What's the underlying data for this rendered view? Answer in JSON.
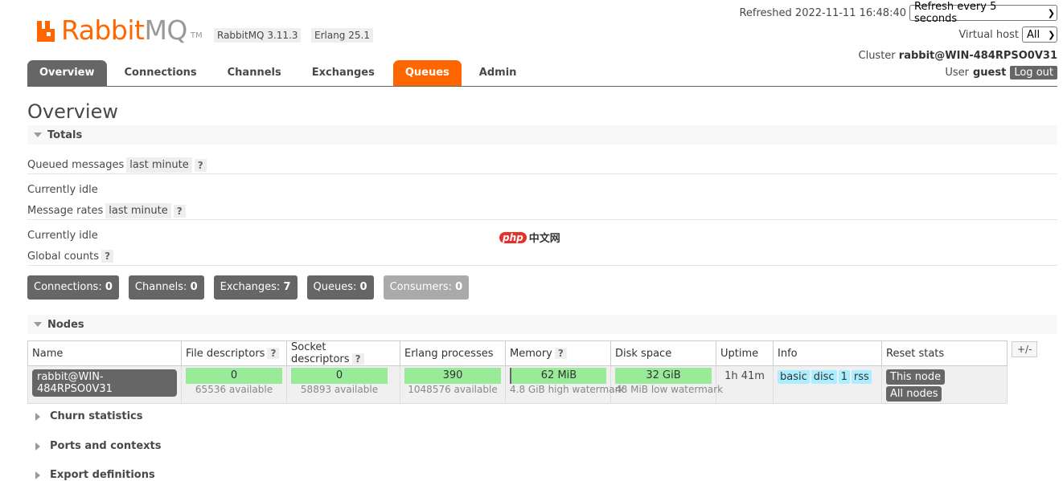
{
  "header": {
    "logo_text_1": "Rabbit",
    "logo_text_2": "MQ",
    "logo_tm": "TM",
    "version": "RabbitMQ 3.11.3",
    "erlang": "Erlang 25.1",
    "refreshed": "Refreshed 2022-11-11 16:48:40",
    "refresh_select": "Refresh every 5 seconds",
    "vhost_label": "Virtual host",
    "vhost_select": "All",
    "cluster_label": "Cluster",
    "cluster_name": "rabbit@WIN-484RPSO0V31",
    "user_label": "User",
    "user_name": "guest",
    "logout": "Log out"
  },
  "tabs": [
    "Overview",
    "Connections",
    "Channels",
    "Exchanges",
    "Queues",
    "Admin"
  ],
  "page_title": "Overview",
  "totals": {
    "header": "Totals",
    "queued_label": "Queued messages",
    "queued_pill": "last minute",
    "help": "?",
    "idle_1": "Currently idle",
    "rates_label": "Message rates",
    "rates_pill": "last minute",
    "idle_2": "Currently idle",
    "global_label": "Global counts"
  },
  "counts": [
    {
      "label": "Connections:",
      "value": "0"
    },
    {
      "label": "Channels:",
      "value": "0"
    },
    {
      "label": "Exchanges:",
      "value": "7"
    },
    {
      "label": "Queues:",
      "value": "0"
    },
    {
      "label": "Consumers:",
      "value": "0"
    }
  ],
  "nodes": {
    "header": "Nodes",
    "columns": [
      "Name",
      "File descriptors",
      "Socket descriptors",
      "Erlang processes",
      "Memory",
      "Disk space",
      "Uptime",
      "Info",
      "Reset stats"
    ],
    "row": {
      "name": "rabbit@WIN-484RPSO0V31",
      "fd": "0",
      "fd_sub": "65536 available",
      "sd": "0",
      "sd_sub": "58893 available",
      "ep": "390",
      "ep_sub": "1048576 available",
      "mem": "62 MiB",
      "mem_sub": "4.8 GiB high watermark",
      "disk": "32 GiB",
      "disk_sub": "48 MiB low watermark",
      "uptime": "1h 41m",
      "info": [
        "basic",
        "disc",
        "1",
        "rss"
      ],
      "reset_this": "This node",
      "reset_all": "All nodes"
    },
    "plusminus": "+/-"
  },
  "collapsed_sections": [
    "Churn statistics",
    "Ports and contexts",
    "Export definitions"
  ],
  "watermark": {
    "php": "php",
    "text": "中文网"
  },
  "colors": {
    "accent": "#ff6600",
    "tab_active": "#666666",
    "bar": "#99eb99",
    "info": "#aaeeff"
  }
}
